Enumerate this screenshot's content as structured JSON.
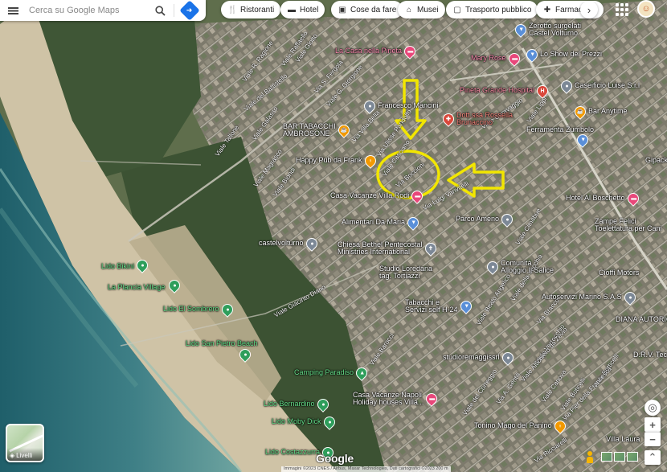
{
  "search": {
    "placeholder": "Cerca su Google Maps"
  },
  "chips": [
    {
      "label": "Ristoranti",
      "icon": "fork-knife-icon"
    },
    {
      "label": "Hotel",
      "icon": "bed-icon"
    },
    {
      "label": "Cose da fare",
      "icon": "camera-icon"
    },
    {
      "label": "Musei",
      "icon": "museum-icon"
    },
    {
      "label": "Trasporto pubblico",
      "icon": "transit-icon"
    },
    {
      "label": "Farmac",
      "icon": "pharmacy-icon"
    }
  ],
  "layers": {
    "label": "Livelli"
  },
  "brand": {
    "logo": "Google"
  },
  "attribution": "Immagini ©2023 CNES / Airbus, Maxar Technologies, Dati cartografici ©2023",
  "scale": "200 m",
  "places": {
    "lido_bikini": "Lido Bikini",
    "la_plancia": "La Plancia Village",
    "lido_sombrero": "Lido El Sombrero",
    "lido_san_pietro": "Lido San Pietro Beach",
    "camping_paradiso": "Camping Paradiso",
    "lido_bernardino": "Lido Bernardino",
    "lido_moby_dick": "Lido Moby Dick",
    "lido_costazzurra": "Lido Costazzurra",
    "casa_pineta": "La Casa nella Pineta",
    "mary_rose": "Mary Rose",
    "francesco_mancini": "Francesco Mancini",
    "bar_tabacchi": "BAR TABACCHI\nAMBROSONE",
    "happy_pub": "Happy Pub da Frank",
    "casa_vanzanze_vill": "Casa Vacanze Villa Rodi",
    "alimentari_maria": "Alimentari Da Maria",
    "castelvolturno": "castelvolturno",
    "chiesa_bethel": "Chiesa Bethel Pentecostal\nMinistries International",
    "studio_loredana": "Studio Loredana\ntag. Tortiazzi",
    "tabacchi_servizi": "Tabacchi e\nServizi self H-24",
    "parco_ameno": "Parco Ameno",
    "comunita_salice": "Comunità\nAlloggio Il Salice",
    "studio_remaggio": "studioremaggissrl",
    "casa_vacanze_napoli": "Casa Vacanze Napoli\nHoliday houses Villa...",
    "tonino_mago": "Tonino Mago del Panino",
    "zerotto": "Zerotto surgelati\nCastel Volturno",
    "show_prezzi": "Lo Show dei Prezzi",
    "caseificio_luise": "Caseificio Luise S.r.l",
    "pineta_grande": "Pineta Grande Hospital",
    "dottssa_rossella": "Dott.ssa Rossella\nBrunaccino",
    "bar_anytime": "Bar Anytime",
    "ferramenta_zumbolo": "Ferramenta Zumbolo",
    "hotel_boschetto": "Hotel Al Boschetto",
    "zampe_felici": "Zampe Felici\nToelettatura per Cani",
    "cioffi_motors": "Cioffi Motors",
    "autoservizi_marino": "Autoservizi Marino S.A.S",
    "diana_autorico": "DIANA AUTORIC",
    "drv_tecn": "D.R.V. Tecn",
    "villa_laura": "Villa Laura",
    "gipack": "Gipack"
  },
  "streets": {
    "s1": "Viale R. Ragione",
    "s2": "Viale Raffaello",
    "s3": "Viale del Battistello",
    "s4": "Viale Giotto",
    "s5": "Via S. Fergola",
    "s6": "Viale G. Giorgione",
    "s7": "Viale Tallone",
    "s8": "Via Villa Bella",
    "s9": "Via Ulisse Pandolfo",
    "s10": "Viale Casciano",
    "s11": "Viale Magrasco",
    "s12": "Viale Biondi",
    "s13": "Viale Galasso",
    "s14": "Via Boccioni",
    "s15": "Via Luigi Vanvitelli",
    "s16": "Viale Giacinto Diano",
    "s17": "Viale Cimabue",
    "s18": "Viale della Vecchia",
    "s19": "Via Bracco",
    "s20": "Viale Beato Angelico",
    "s21": "Viale del Correggio",
    "s22": "Via A. Gentili",
    "s23": "Viale Canova",
    "s24": "Viale Botticelli",
    "s25": "Via Pier della Francesca",
    "s26": "Viale Verrocchio",
    "s27": "Viale Altichiero da Zevio",
    "s28": "Viale Caravaggio",
    "s29": "Viale Lippi",
    "s30": "Viale Barocci",
    "s31": "Viale Boticelli",
    "s32": "Via Ricciarelli"
  },
  "annotations": {
    "circle_color": "#f2e600",
    "arrow_color": "#f2e600"
  }
}
